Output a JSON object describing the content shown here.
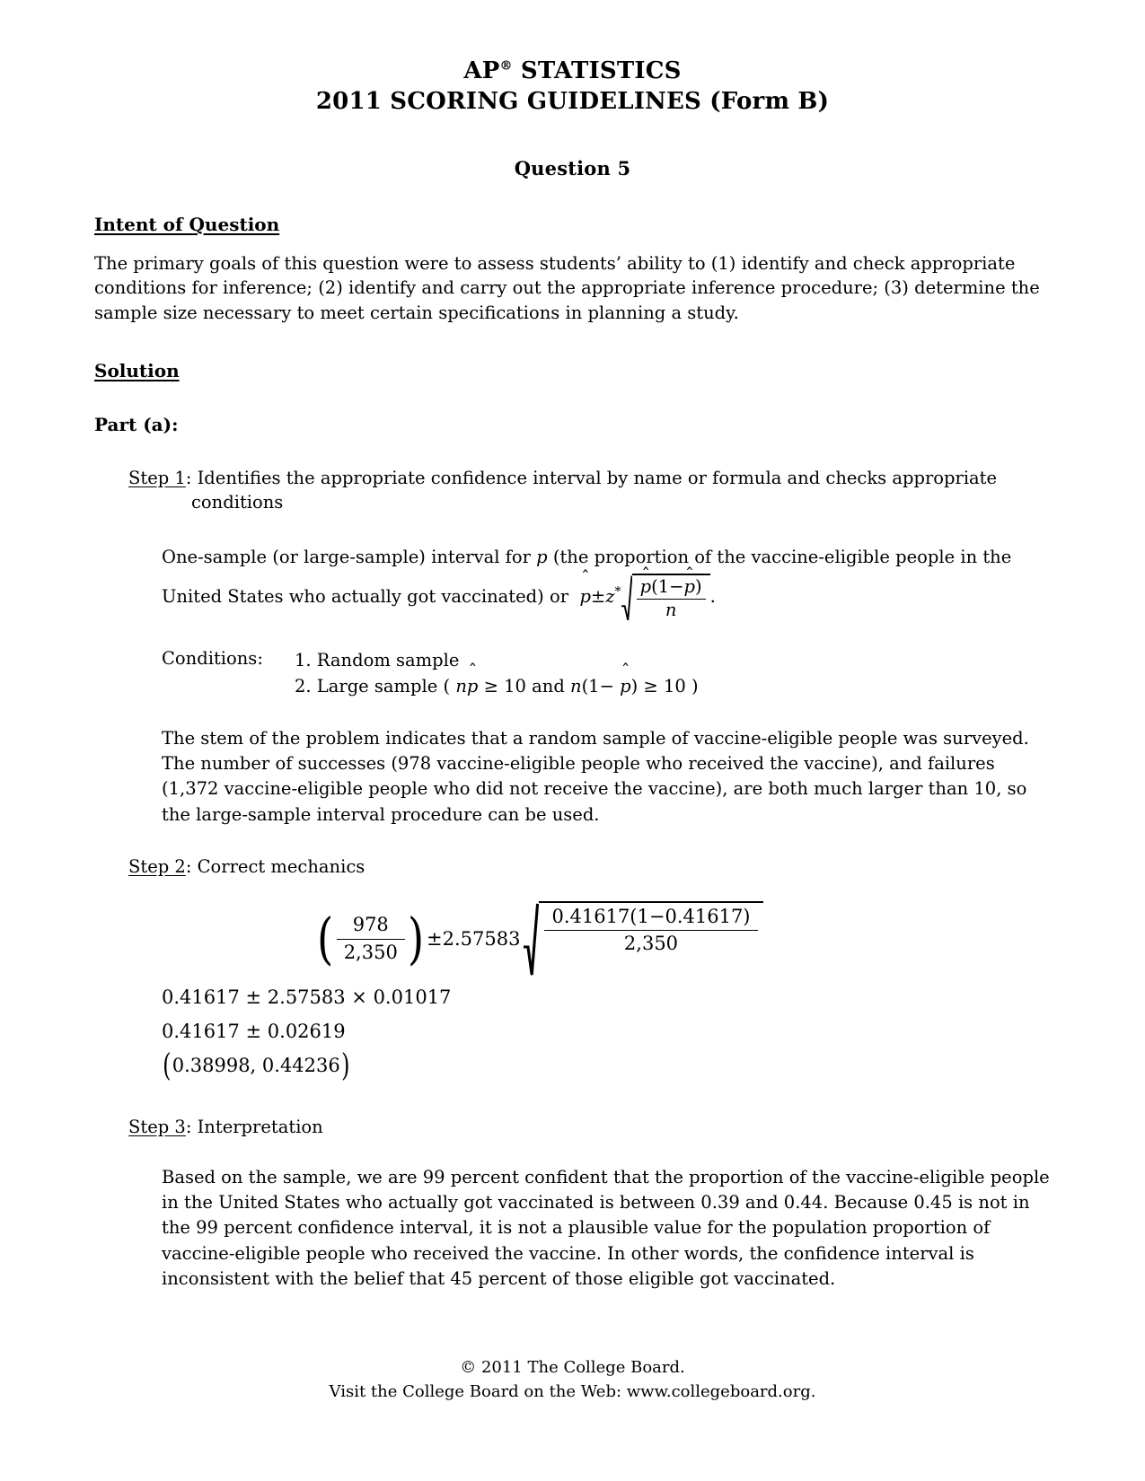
{
  "header": {
    "line1_prefix": "AP",
    "line1_reg": "®",
    "line1_suffix": " STATISTICS",
    "line2": "2011 SCORING GUIDELINES (Form B)",
    "question_title": "Question 5"
  },
  "sections": {
    "intent_heading": "Intent of Question",
    "intent_body": "The primary goals of this question were to assess students’ ability to (1) identify and check appropriate conditions for inference; (2) identify and carry out the appropriate inference procedure; (3) determine the sample size necessary to meet certain specifications in planning a study.",
    "solution_heading": "Solution",
    "part_a_heading": "Part (a):"
  },
  "step1": {
    "label": "Step 1",
    "colon_text": ": Identifies the appropriate confidence interval by name or formula and checks appropriate",
    "continuation": "conditions",
    "interval_text_part1": "One-sample (or large-sample) interval for ",
    "interval_var": "p",
    "interval_text_part2": " (the proportion of the vaccine-eligible people in the",
    "interval_text_line2": "United States who actually got vaccinated) or ",
    "formula": {
      "phat": "p",
      "pm": "±",
      "z": "z",
      "star": "*",
      "numerator_phat1": "p",
      "numerator_mid": "(1−",
      "numerator_phat2": "p",
      "numerator_close": ")",
      "denominator": "n",
      "period": "."
    },
    "conditions_label": "Conditions:",
    "condition_1": "1. Random sample",
    "condition_2": {
      "prefix": "2. Large sample (",
      "n1": "n",
      "phat1": "p",
      "ge1": " ≥ 10",
      "and": "  and  ",
      "n2": "n",
      "open": "(1−",
      "phat2": "p",
      "close": ")",
      "ge2": " ≥ 10",
      "suffix": ")"
    },
    "stem_paragraph": "The stem of the problem indicates that a random sample of vaccine-eligible people was surveyed. The number of successes (978 vaccine-eligible people who received the vaccine), and failures (1,372 vaccine-eligible people who did not receive the vaccine), are both much larger than 10, so the large-sample interval procedure can be used."
  },
  "step2": {
    "label": "Step 2",
    "colon_text": ": Correct mechanics",
    "math": {
      "frac1_num": "978",
      "frac1_den": "2,350",
      "pm": "±",
      "zstar": "2.57583",
      "sqrt_num": "0.41617(1−0.41617)",
      "sqrt_den": "2,350",
      "line2": "0.41617 ± 2.57583 × 0.01017",
      "line3": "0.41617 ± 0.02619",
      "line4_open": "(",
      "line4_values": "0.38998, 0.44236",
      "line4_close": ")"
    }
  },
  "step3": {
    "label": "Step 3",
    "colon_text": ": Interpretation",
    "paragraph": "Based on the sample, we are 99 percent confident that the proportion of the vaccine-eligible people in the United States who actually got vaccinated is between 0.39 and 0.44. Because 0.45 is not in the 99 percent confidence interval, it is not a plausible value for the population proportion of vaccine-eligible people who received the vaccine. In other words, the confidence interval is inconsistent with the belief that 45 percent of those eligible got vaccinated."
  },
  "footer": {
    "copyright": "© 2011 The College Board.",
    "visit": "Visit the College Board on the Web: www.collegeboard.org."
  }
}
